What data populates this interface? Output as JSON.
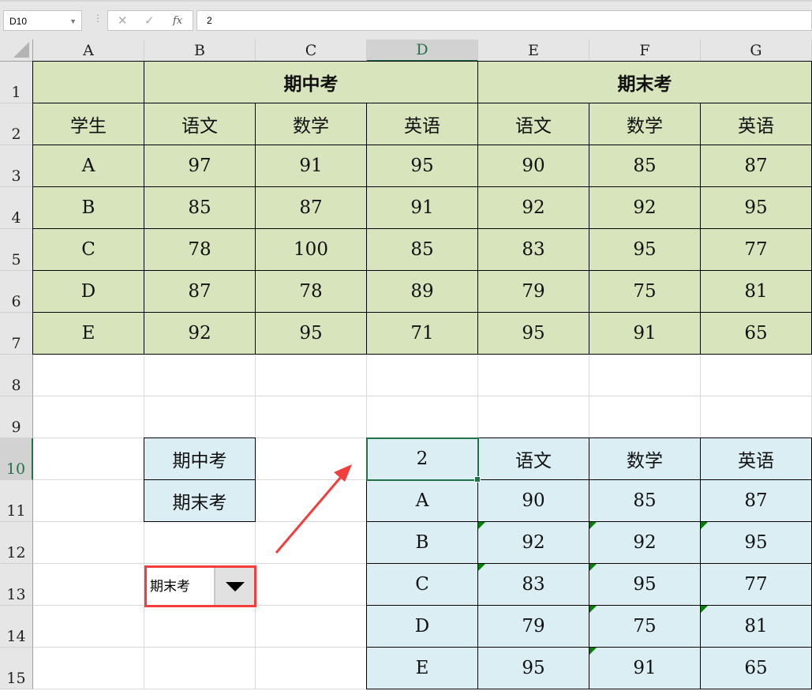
{
  "formula_bar": {
    "name_box": "D10",
    "cancel_icon": "✕",
    "enter_icon": "✓",
    "fx_label": "fx",
    "formula": "2"
  },
  "columns": [
    "A",
    "B",
    "C",
    "D",
    "E",
    "F",
    "G"
  ],
  "rows": [
    "1",
    "2",
    "3",
    "4",
    "5",
    "6",
    "7",
    "8",
    "9",
    "10",
    "11",
    "12",
    "13",
    "14",
    "15"
  ],
  "selected_cell": "D10",
  "cells": {
    "B1": "期中考",
    "E1": "期末考",
    "A2": "学生",
    "B2": "语文",
    "C2": "数学",
    "D2": "英语",
    "E2": "语文",
    "F2": "数学",
    "G2": "英语",
    "A3": "A",
    "B3": "97",
    "C3": "91",
    "D3": "95",
    "E3": "90",
    "F3": "85",
    "G3": "87",
    "A4": "B",
    "B4": "85",
    "C4": "87",
    "D4": "91",
    "E4": "92",
    "F4": "92",
    "G4": "95",
    "A5": "C",
    "B5": "78",
    "C5": "100",
    "D5": "85",
    "E5": "83",
    "F5": "95",
    "G5": "77",
    "A6": "D",
    "B6": "87",
    "C6": "78",
    "D6": "89",
    "E6": "79",
    "F6": "75",
    "G6": "81",
    "A7": "E",
    "B7": "92",
    "C7": "95",
    "D7": "71",
    "E7": "95",
    "F7": "91",
    "G7": "65",
    "B10": "期中考",
    "B11": "期末考",
    "D10": "2",
    "E10": "语文",
    "F10": "数学",
    "G10": "英语",
    "D11": "A",
    "E11": "90",
    "F11": "85",
    "G11": "87",
    "D12": "B",
    "E12": "92",
    "F12": "92",
    "G12": "95",
    "D13": "C",
    "E13": "83",
    "F13": "95",
    "G13": "77",
    "D14": "D",
    "E14": "79",
    "F14": "75",
    "G14": "81",
    "D15": "E",
    "E15": "95",
    "F15": "91",
    "G15": "65"
  },
  "error_indicators": [
    "E12",
    "F12",
    "G12",
    "E13",
    "F13",
    "F14",
    "G14",
    "F15"
  ],
  "combo_box": {
    "value": "期末考",
    "arrow_icon": "triangle-down-icon"
  },
  "colors": {
    "green_fill": "#d8e4bc",
    "blue_fill": "#daeef3",
    "selection": "#217346",
    "highlight": "#f33c3c"
  }
}
